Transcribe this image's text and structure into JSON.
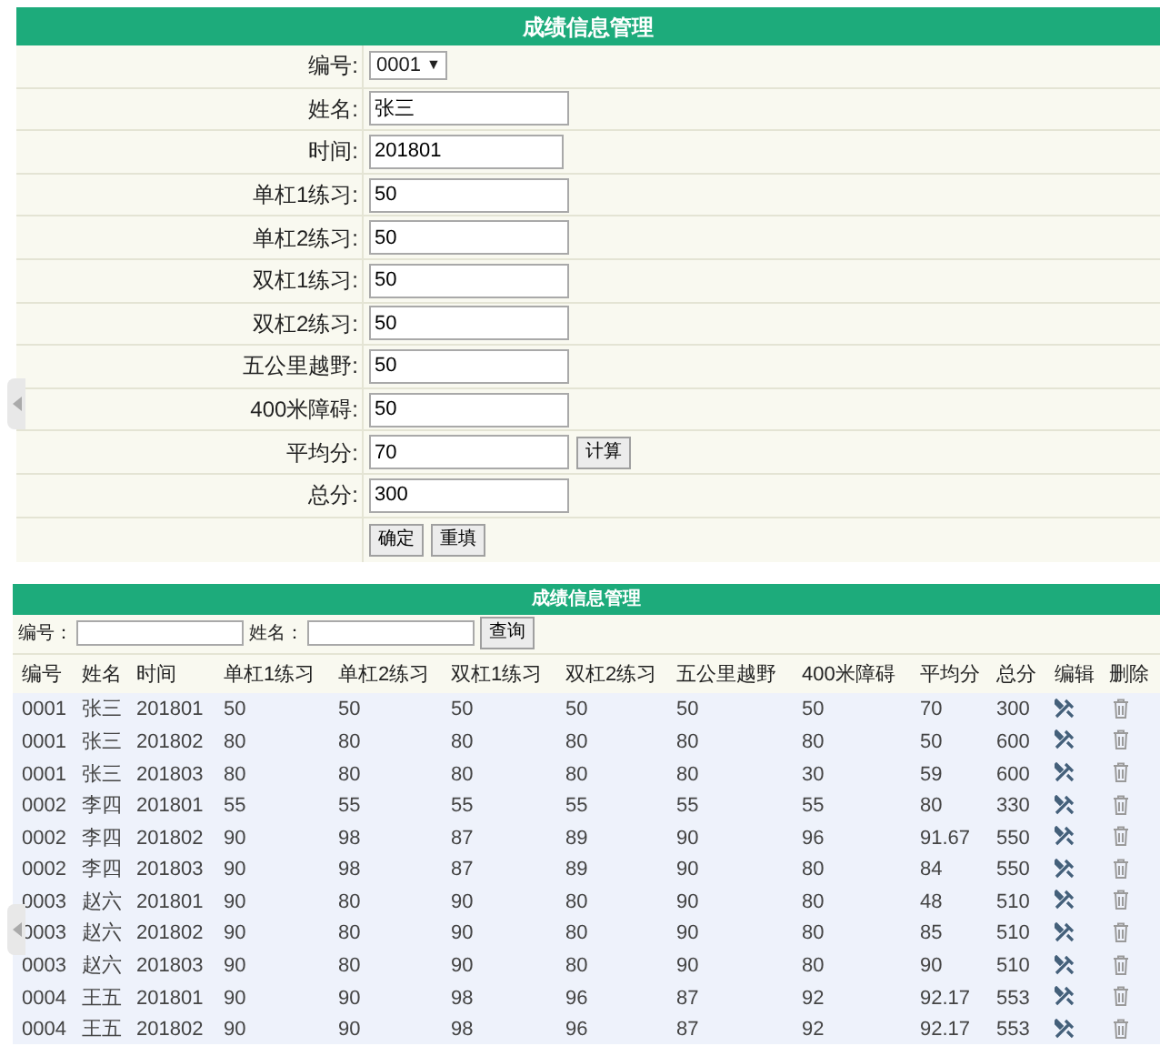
{
  "form": {
    "title": "成绩信息管理",
    "fields": [
      {
        "kind": "select",
        "label": "编号:",
        "value": "0001",
        "caret": "▼"
      },
      {
        "kind": "input",
        "label": "姓名:",
        "value": "张三"
      },
      {
        "kind": "input",
        "label": "时间:",
        "value": "201801"
      },
      {
        "kind": "input",
        "label": "单杠1练习:",
        "value": "50"
      },
      {
        "kind": "input",
        "label": "单杠2练习:",
        "value": "50"
      },
      {
        "kind": "input",
        "label": "双杠1练习:",
        "value": "50"
      },
      {
        "kind": "input",
        "label": "双杠2练习:",
        "value": "50"
      },
      {
        "kind": "input",
        "label": "五公里越野:",
        "value": "50"
      },
      {
        "kind": "input",
        "label": "400米障碍:",
        "value": "50"
      },
      {
        "kind": "input",
        "label": "平均分:",
        "value": "70",
        "button": "计算"
      },
      {
        "kind": "input",
        "label": "总分:",
        "value": "300"
      }
    ],
    "buttons": [
      "确定",
      "重填"
    ]
  },
  "list": {
    "title": "成绩信息管理",
    "search": [
      {
        "label": "编号："
      },
      {
        "label": "姓名："
      }
    ],
    "search_button": "查询",
    "columns": [
      "编号",
      "姓名",
      "时间",
      "单杠1练习",
      "单杠2练习",
      "双杠1练习",
      "双杠2练习",
      "五公里越野",
      "400米障碍",
      "平均分",
      "总分",
      "编辑",
      "删除"
    ],
    "rows": [
      [
        "0001",
        "张三",
        "201801",
        "50",
        "50",
        "50",
        "50",
        "50",
        "50",
        "70",
        "300"
      ],
      [
        "0001",
        "张三",
        "201802",
        "80",
        "80",
        "80",
        "80",
        "80",
        "80",
        "50",
        "600"
      ],
      [
        "0001",
        "张三",
        "201803",
        "80",
        "80",
        "80",
        "80",
        "80",
        "30",
        "59",
        "600"
      ],
      [
        "0002",
        "李四",
        "201801",
        "55",
        "55",
        "55",
        "55",
        "55",
        "55",
        "80",
        "330"
      ],
      [
        "0002",
        "李四",
        "201802",
        "90",
        "98",
        "87",
        "89",
        "90",
        "96",
        "91.67",
        "550"
      ],
      [
        "0002",
        "李四",
        "201803",
        "90",
        "98",
        "87",
        "89",
        "90",
        "80",
        "84",
        "550"
      ],
      [
        "0003",
        "赵六",
        "201801",
        "90",
        "80",
        "90",
        "80",
        "90",
        "80",
        "48",
        "510"
      ],
      [
        "0003",
        "赵六",
        "201802",
        "90",
        "80",
        "90",
        "80",
        "90",
        "80",
        "85",
        "510"
      ],
      [
        "0003",
        "赵六",
        "201803",
        "90",
        "80",
        "90",
        "80",
        "90",
        "80",
        "90",
        "510"
      ],
      [
        "0004",
        "王五",
        "201801",
        "90",
        "90",
        "98",
        "96",
        "87",
        "92",
        "92.17",
        "553"
      ],
      [
        "0004",
        "王五",
        "201802",
        "90",
        "90",
        "98",
        "96",
        "87",
        "92",
        "92.17",
        "553"
      ]
    ]
  }
}
